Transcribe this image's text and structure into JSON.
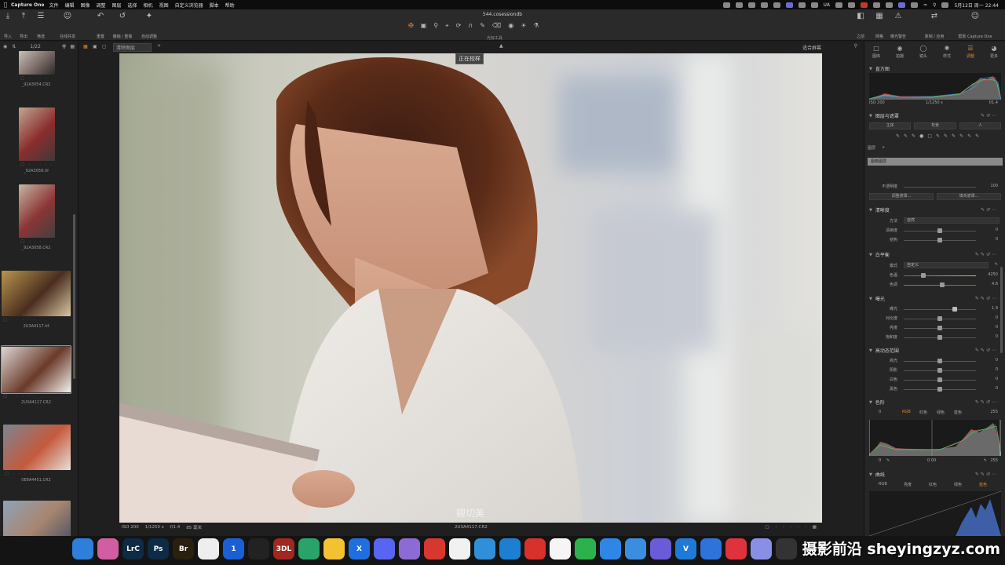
{
  "menubar": {
    "app_name": "Capture One",
    "items": [
      "文件",
      "编辑",
      "图像",
      "调整",
      "图层",
      "选择",
      "相机",
      "视图",
      "自定义浏览器",
      "脚本",
      "帮助"
    ],
    "input_method": "UA",
    "datetime": "5月12日 周一 22:44"
  },
  "toolbar": {
    "document_title": "544.cosessiondb",
    "left_buttons": [
      "导入",
      "导出",
      "筛选",
      "在线共享",
      "重置",
      "撤销 / 重做",
      "自动调整"
    ],
    "cursor_tools_label": "光标工具",
    "right_buttons": [
      "之前",
      "网格",
      "曝光警告",
      "复制 / 应用",
      "帮助 Capture One"
    ]
  },
  "browser": {
    "counter": "1/22",
    "thumbnails": [
      {
        "name": "_92A3054.CR2",
        "colors": [
          "#c7c0b8",
          "#7a6b66",
          "#2c2a2a"
        ]
      },
      {
        "name": "_92A3058.tif",
        "colors": [
          "#bfa791",
          "#8a2d2d",
          "#3d3a3a"
        ]
      },
      {
        "name": "_92A3058.CR2",
        "colors": [
          "#c5b6a2",
          "#8b3535",
          "#404040"
        ]
      },
      {
        "name": "2U3A4117.tif",
        "colors": [
          "#b8954d",
          "#4a2e1e",
          "#d9c7a3"
        ]
      },
      {
        "name": "2U3A4117.CR2",
        "colors": [
          "#dcd6d2",
          "#6b3a2a",
          "#f3f1ee"
        ]
      },
      {
        "name": "0E8A4451.CR2",
        "colors": [
          "#7c8592",
          "#c45a3c",
          "#e7e0d8"
        ]
      },
      {
        "name": "",
        "colors": [
          "#8ea3b8",
          "#a88570",
          "#4d5561"
        ]
      }
    ]
  },
  "viewer": {
    "preset": "清除图层",
    "fit_label": "适合屏幕",
    "status_badge": "正在校样",
    "meta_iso": "ISO 200",
    "meta_shutter": "1/1250 s",
    "meta_aperture": "f/1.4",
    "meta_focal": "85 毫米",
    "filename": "2U3A4117.CR2",
    "signature": "親切美"
  },
  "panel": {
    "tabs": [
      "图库",
      "拍摄",
      "镜头",
      "样式",
      "调整",
      "更多"
    ],
    "active_tab": "调整",
    "histogram": {
      "title": "直方图",
      "iso": "ISO 200",
      "shutter": "1/1250 s",
      "aperture": "f/1.4"
    },
    "layers": {
      "title": "图层与遮罩",
      "btn_subject": "主体",
      "btn_background": "背景",
      "btn_person": "人",
      "layers_label": "图层",
      "layer_name": "图像图层",
      "opacity_label": "不透明度",
      "opacity_value": "100",
      "btn_refine": "调整遮罩...",
      "btn_fill": "填充遮罩..."
    },
    "clarity": {
      "title": "清晰度",
      "method_label": "方法",
      "method_value": "自然",
      "clarity_label": "清晰度",
      "clarity_value": "0",
      "structure_label": "结构",
      "structure_value": "0"
    },
    "white_balance": {
      "title": "白平衡",
      "mode_label": "模式",
      "mode_value": "自定义",
      "kelvin_label": "色温",
      "kelvin_value": "4250",
      "tint_label": "色调",
      "tint_value": "4.6"
    },
    "exposure": {
      "title": "曝光",
      "rows": [
        {
          "label": "曝光",
          "value": "1.9"
        },
        {
          "label": "对比度",
          "value": "0"
        },
        {
          "label": "亮度",
          "value": "0"
        },
        {
          "label": "饱和度",
          "value": "0"
        }
      ]
    },
    "hdr": {
      "title": "高动态范围",
      "rows": [
        {
          "label": "高光",
          "value": "0"
        },
        {
          "label": "阴影",
          "value": "0"
        },
        {
          "label": "白色",
          "value": "0"
        },
        {
          "label": "黑色",
          "value": "0"
        }
      ]
    },
    "levels": {
      "title": "色阶",
      "tabs": [
        "RGB",
        "红色",
        "绿色",
        "蓝色"
      ],
      "active": "RGB",
      "low": "0",
      "high": "255",
      "out_low": "0",
      "mid": "0.00",
      "out_high": "255"
    },
    "curve": {
      "title": "曲线",
      "tabs": [
        "RGB",
        "亮度",
        "红色",
        "绿色",
        "蓝色"
      ],
      "active": "蓝色"
    }
  },
  "dock": {
    "icons": [
      {
        "name": "finder-icon",
        "label": "",
        "color": "#2e7fd9"
      },
      {
        "name": "launchpad-icon",
        "label": "",
        "color": "#d15da3"
      },
      {
        "name": "lightroom-classic-icon",
        "label": "LrC",
        "color": "#0f2a44"
      },
      {
        "name": "photoshop-icon",
        "label": "Ps",
        "color": "#0e2a47"
      },
      {
        "name": "bridge-icon",
        "label": "Br",
        "color": "#2b1f0d"
      },
      {
        "name": "window-manager-icon",
        "label": "",
        "color": "#eeeeee"
      },
      {
        "name": "1password-icon",
        "label": "1",
        "color": "#1a5fd6"
      },
      {
        "name": "capcut-icon",
        "label": "",
        "color": "#222222"
      },
      {
        "name": "3dl-icon",
        "label": "3DL",
        "color": "#a0281f"
      },
      {
        "name": "settings-icon",
        "label": "",
        "color": "#29a36a"
      },
      {
        "name": "vpn-icon",
        "label": "",
        "color": "#f2c230"
      },
      {
        "name": "x-icon",
        "label": "X",
        "color": "#1f6fe0"
      },
      {
        "name": "discord-icon",
        "label": "",
        "color": "#5865f2"
      },
      {
        "name": "photos-tool-icon",
        "label": "",
        "color": "#8c6bd6"
      },
      {
        "name": "netease-music-icon",
        "label": "",
        "color": "#d8372f"
      },
      {
        "name": "chrome-icon",
        "label": "",
        "color": "#f1f1f1"
      },
      {
        "name": "controller-icon",
        "label": "",
        "color": "#2f8fd8"
      },
      {
        "name": "edge-icon",
        "label": "",
        "color": "#1d7fd1"
      },
      {
        "name": "xmind-icon",
        "label": "",
        "color": "#d8302a"
      },
      {
        "name": "qq-icon",
        "label": "",
        "color": "#f5f5f5"
      },
      {
        "name": "wechat-icon",
        "label": "",
        "color": "#2bb24c"
      },
      {
        "name": "baidu-netdisk-icon",
        "label": "",
        "color": "#2e87e6"
      },
      {
        "name": "bird-icon",
        "label": "",
        "color": "#3b8de0"
      },
      {
        "name": "player-icon",
        "label": "",
        "color": "#6a5bd8"
      },
      {
        "name": "v-icon",
        "label": "V",
        "color": "#1e7ad6"
      },
      {
        "name": "airdrop-icon",
        "label": "",
        "color": "#2d73d9"
      },
      {
        "name": "weibo-icon",
        "label": "",
        "color": "#e0323d"
      },
      {
        "name": "gallery-icon",
        "label": "",
        "color": "#8a8fe6"
      },
      {
        "name": "clock-icon",
        "label": "",
        "color": "#333333"
      }
    ]
  },
  "watermark": "摄影前沿 sheyingzyz.com",
  "colors": {
    "accent": "#e08a2e",
    "panel_bg": "#262626",
    "viewer_bg": "#1f1f1f"
  }
}
